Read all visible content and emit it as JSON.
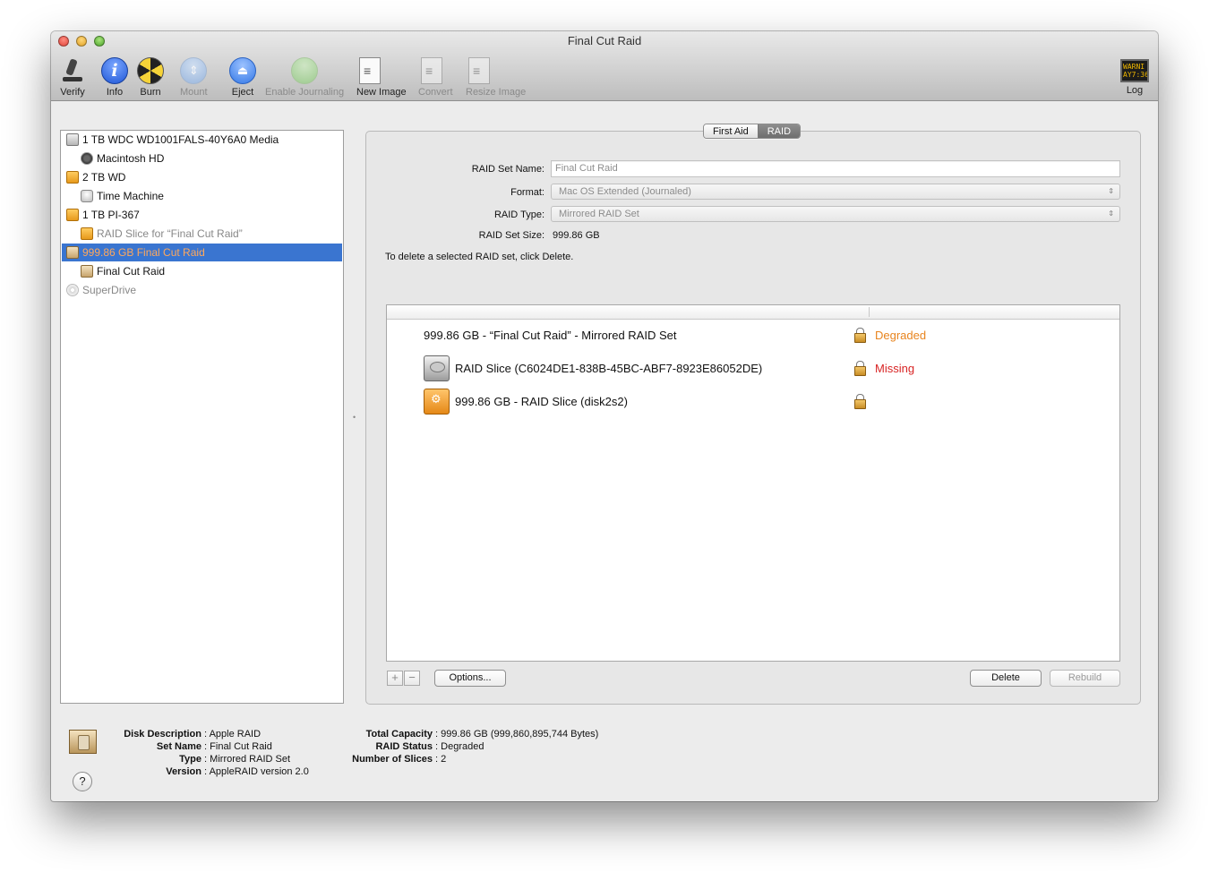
{
  "window": {
    "title": "Final Cut Raid"
  },
  "toolbar": {
    "items": [
      {
        "id": "verify",
        "label": "Verify",
        "icon": "microscope-icon",
        "enabled": true
      },
      {
        "id": "info",
        "label": "Info",
        "icon": "info-icon",
        "enabled": true
      },
      {
        "id": "burn",
        "label": "Burn",
        "icon": "burn-icon",
        "enabled": true
      },
      {
        "id": "mount",
        "label": "Mount",
        "icon": "mount-icon",
        "enabled": false
      },
      {
        "id": "eject",
        "label": "Eject",
        "icon": "eject-icon",
        "enabled": true
      },
      {
        "id": "enable_journaling",
        "label": "Enable Journaling",
        "icon": "journaling-icon",
        "enabled": false
      },
      {
        "id": "new_image",
        "label": "New Image",
        "icon": "new-image-icon",
        "enabled": true
      },
      {
        "id": "convert",
        "label": "Convert",
        "icon": "convert-icon",
        "enabled": false
      },
      {
        "id": "resize_image",
        "label": "Resize Image",
        "icon": "resize-image-icon",
        "enabled": false
      }
    ],
    "log": {
      "label": "Log",
      "display_line1": "WARNI",
      "display_line2": "AY7:36"
    },
    "info_glyph": "i",
    "mount_glyph": "⇕",
    "eject_glyph": "⏏"
  },
  "sidebar": {
    "items": [
      {
        "label": "1 TB WDC WD1001FALS-40Y6A0 Media",
        "icon": "hard-disk-icon",
        "level": 0,
        "state": "normal"
      },
      {
        "label": "Macintosh HD",
        "icon": "volume-icon",
        "level": 1,
        "state": "normal"
      },
      {
        "label": "2 TB WD",
        "icon": "external-disk-icon",
        "level": 0,
        "state": "normal"
      },
      {
        "label": "Time Machine",
        "icon": "time-machine-icon",
        "level": 1,
        "state": "normal"
      },
      {
        "label": "1 TB PI-367",
        "icon": "external-disk-icon",
        "level": 0,
        "state": "normal"
      },
      {
        "label": "RAID Slice for “Final Cut Raid”",
        "icon": "external-disk-icon",
        "level": 1,
        "state": "dim"
      },
      {
        "label": "999.86 GB Final Cut Raid",
        "icon": "raid-icon",
        "level": 0,
        "state": "selected"
      },
      {
        "label": "Final Cut Raid",
        "icon": "raid-icon",
        "level": 1,
        "state": "normal"
      },
      {
        "label": "SuperDrive",
        "icon": "superdrive-icon",
        "level": 0,
        "state": "dim"
      }
    ]
  },
  "tabs": {
    "first_aid": "First Aid",
    "raid": "RAID",
    "active": "raid"
  },
  "raid_form": {
    "set_name_label": "RAID Set Name:",
    "set_name_value": "Final Cut Raid",
    "format_label": "Format:",
    "format_value": "Mac OS Extended (Journaled)",
    "type_label": "RAID Type:",
    "type_value": "Mirrored RAID Set",
    "size_label": "RAID Set Size:",
    "size_value": "999.86 GB",
    "hint": "To delete a selected RAID set, click Delete.",
    "popup_arrow": "⇕"
  },
  "raid_table": {
    "rows": [
      {
        "name": "999.86 GB - “Final Cut Raid” - Mirrored RAID Set",
        "status": "Degraded",
        "status_color": "#e8841e",
        "icon": "none"
      },
      {
        "name": "RAID Slice (C6024DE1-838B-45BC-ABF7-8923E86052DE)",
        "status": "Missing",
        "status_color": "#d82424",
        "icon": "internal-disk-icon"
      },
      {
        "name": "999.86 GB - RAID Slice (disk2s2)",
        "status": "",
        "status_color": "#111111",
        "icon": "firewire-disk-icon"
      }
    ]
  },
  "buttons": {
    "add": "+",
    "remove": "−",
    "options": "Options...",
    "delete": "Delete",
    "rebuild": "Rebuild"
  },
  "info_footer": {
    "left": [
      {
        "key": "Disk Description",
        "value": "Apple RAID"
      },
      {
        "key": "Set Name",
        "value": "Final Cut Raid"
      },
      {
        "key": "Type",
        "value": "Mirrored RAID Set"
      },
      {
        "key": "Version",
        "value": "AppleRAID version 2.0"
      }
    ],
    "right": [
      {
        "key": "Total Capacity",
        "value": "999.86 GB (999,860,895,744 Bytes)"
      },
      {
        "key": "RAID Status",
        "value": "Degraded"
      },
      {
        "key": "Number of Slices",
        "value": "2"
      }
    ],
    "help": "?"
  }
}
